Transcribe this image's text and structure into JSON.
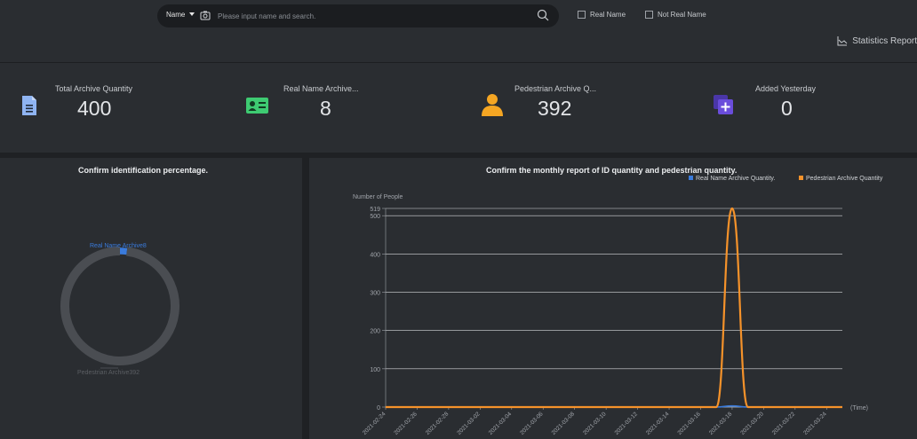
{
  "search": {
    "mode_label": "Name",
    "placeholder": "Please input name and search."
  },
  "filters": {
    "real_name": "Real Name",
    "not_real_name": "Not Real Name"
  },
  "statistics_report": "Statistics Report",
  "cards": [
    {
      "label": "Total Archive Quantity",
      "value": "400",
      "icon": "document-icon",
      "color": "#8fb4f2"
    },
    {
      "label": "Real Name Archive...",
      "value": "8",
      "icon": "id-card-icon",
      "color": "#3ecb72"
    },
    {
      "label": "Pedestrian Archive Q...",
      "value": "392",
      "icon": "person-icon",
      "color": "#f5a623"
    },
    {
      "label": "Added Yesterday",
      "value": "0",
      "icon": "add-layers-icon",
      "color": "#6a4ddb"
    }
  ],
  "pie": {
    "title": "Confirm identification percentage.",
    "label_real": "Real Name Archive8",
    "label_pedestrian": "Pedestrian Archive392",
    "chart_data": {
      "type": "pie",
      "categories": [
        "Real Name Archive",
        "Pedestrian Archive"
      ],
      "values": [
        8,
        392
      ],
      "colors": [
        "#3a7bdc",
        "#4a4d52"
      ]
    }
  },
  "line": {
    "title": "Confirm the monthly report of ID quantity and pedestrian quantity.",
    "ylabel": "Number of People",
    "xlabel": "(Time)",
    "legend": [
      "Real Name Archive Quantity.",
      "Pedestrian Archive Quantity"
    ],
    "chart_data": {
      "type": "line",
      "x": [
        "2021-02-24",
        "2021-02-25",
        "2021-02-26",
        "2021-02-27",
        "2021-02-28",
        "2021-03-01",
        "2021-03-02",
        "2021-03-03",
        "2021-03-04",
        "2021-03-05",
        "2021-03-06",
        "2021-03-07",
        "2021-03-08",
        "2021-03-09",
        "2021-03-10",
        "2021-03-11",
        "2021-03-12",
        "2021-03-13",
        "2021-03-14",
        "2021-03-15",
        "2021-03-16",
        "2021-03-17",
        "2021-03-18",
        "2021-03-19",
        "2021-03-20",
        "2021-03-21",
        "2021-03-22",
        "2021-03-23",
        "2021-03-24",
        "2021-03-25"
      ],
      "xticks": [
        "2021-02-24",
        "2021-02-26",
        "2021-02-28",
        "2021-03-02",
        "2021-03-04",
        "2021-03-06",
        "2021-03-08",
        "2021-03-10",
        "2021-03-12",
        "2021-03-14",
        "2021-03-16",
        "2021-03-18",
        "2021-03-20",
        "2021-03-22",
        "2021-03-24"
      ],
      "yticks": [
        0,
        100,
        200,
        300,
        400,
        500,
        519
      ],
      "ylim": [
        0,
        519
      ],
      "series": [
        {
          "name": "Real Name Archive Quantity.",
          "color": "#3a7bdc",
          "values": [
            0,
            0,
            0,
            0,
            0,
            0,
            0,
            0,
            0,
            0,
            0,
            0,
            0,
            0,
            0,
            0,
            0,
            0,
            0,
            0,
            0,
            0,
            3,
            0,
            0,
            0,
            0,
            0,
            0,
            0
          ]
        },
        {
          "name": "Pedestrian Archive Quantity",
          "color": "#f5922a",
          "values": [
            0,
            0,
            0,
            0,
            0,
            0,
            0,
            0,
            0,
            0,
            0,
            0,
            0,
            0,
            0,
            0,
            0,
            0,
            0,
            0,
            0,
            0,
            519,
            0,
            0,
            0,
            0,
            0,
            0,
            0
          ]
        }
      ]
    }
  }
}
